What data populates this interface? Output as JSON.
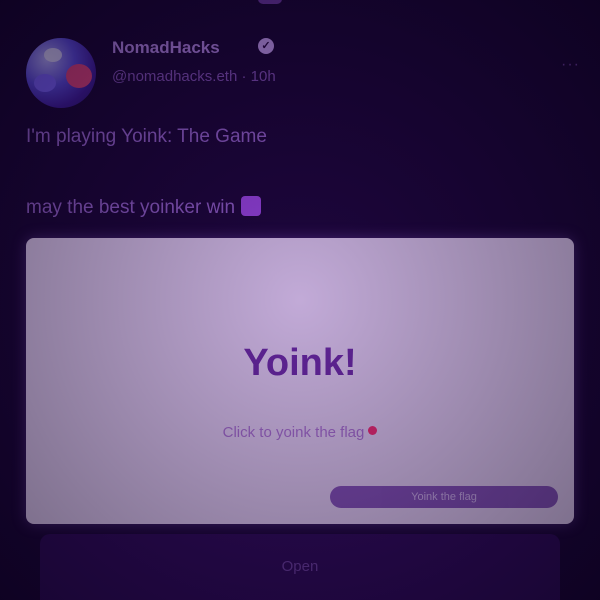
{
  "cast": {
    "author_display_name": "NomadHacks",
    "author_handle": "@nomadhacks.eth",
    "time_ago": "10h",
    "text_line1": "I'm playing Yoink: The Game",
    "text_line2": "may the best yoinker win",
    "more_label": "···"
  },
  "frame": {
    "title": "Yoink!",
    "subtitle": "Click to yoink the flag",
    "button_label": "Yoink the flag"
  },
  "bottom": {
    "label": "Open"
  },
  "colors": {
    "background": "#14052e",
    "card": "#efe0fb",
    "accent": "#6d2da6",
    "flag": "#ff2f6e"
  }
}
